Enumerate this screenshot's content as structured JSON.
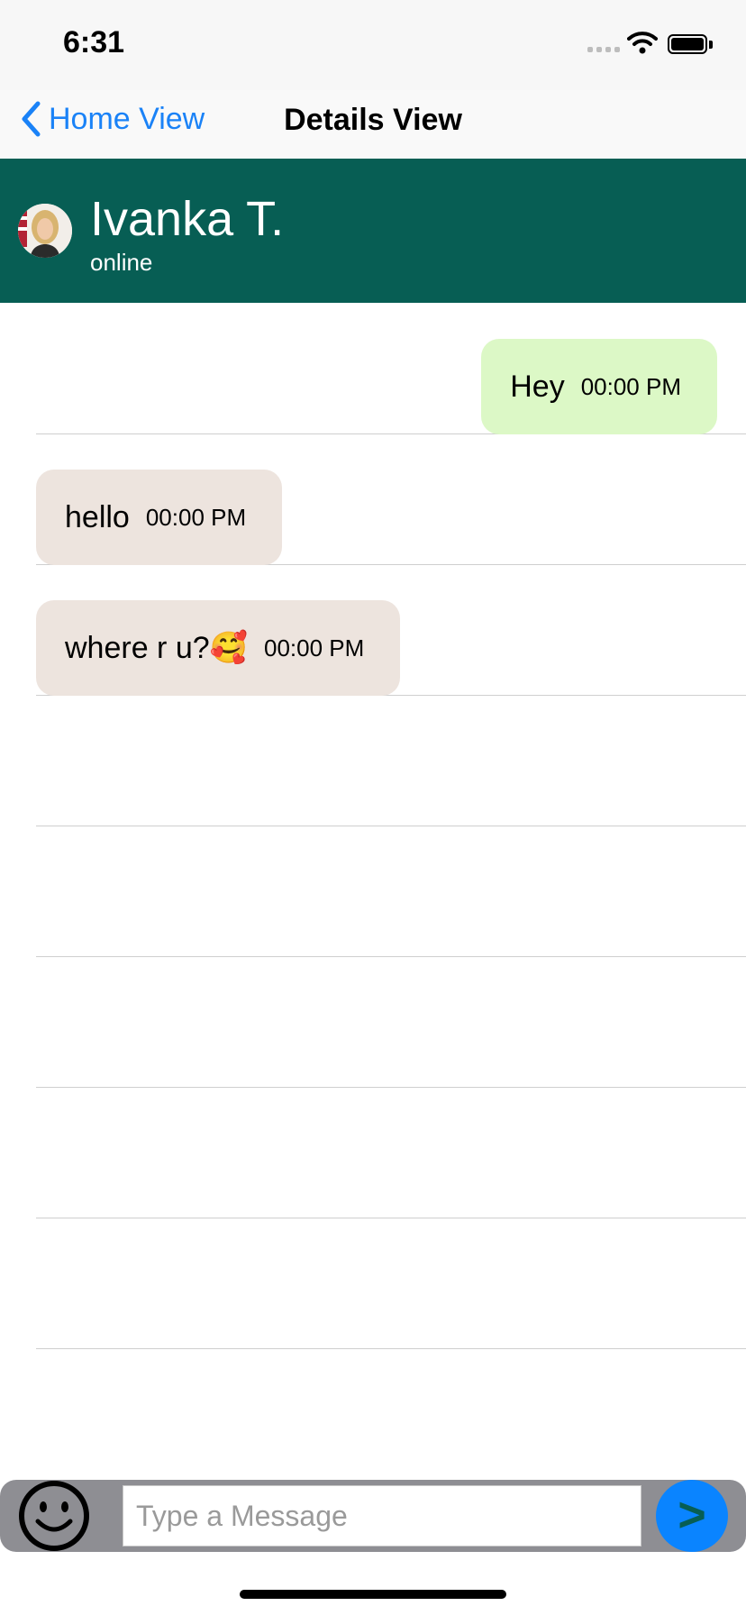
{
  "status_bar": {
    "time": "6:31"
  },
  "nav": {
    "back_label": "Home View",
    "title": "Details View"
  },
  "contact": {
    "name": "Ivanka T.",
    "status": "online"
  },
  "messages": [
    {
      "direction": "out",
      "text": "Hey",
      "time": "00:00 PM"
    },
    {
      "direction": "in",
      "text": "hello",
      "time": "00:00 PM"
    },
    {
      "direction": "in",
      "text": "where r u?🥰",
      "time": "00:00 PM"
    }
  ],
  "composer": {
    "placeholder": "Type a Message",
    "value": "",
    "send_glyph": ">"
  },
  "icons": {
    "back": "chevron-left-icon",
    "emoji": "smiley-face-icon",
    "wifi": "wifi-icon",
    "battery": "battery-icon"
  },
  "colors": {
    "header": "#075e54",
    "accent": "#1a82f7",
    "outgoing_bubble": "#dcf8c6",
    "incoming_bubble": "#ede4de",
    "send_button": "#0a84ff"
  }
}
